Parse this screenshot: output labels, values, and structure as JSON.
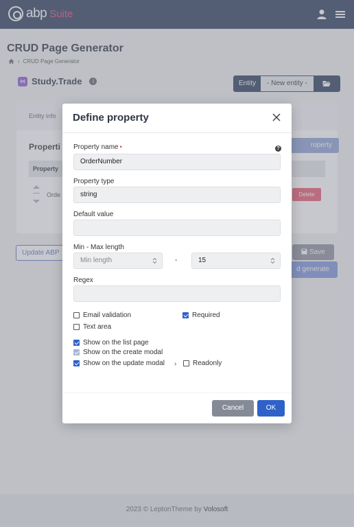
{
  "topbar": {
    "logo_text": "abp",
    "logo_suite": "Suite",
    "user_icon": "user-icon",
    "menu_icon": "hamburger-menu-icon"
  },
  "page": {
    "title": "CRUD Page Generator",
    "breadcrumb": "CRUD Page Generator"
  },
  "solution": {
    "name": "Study.Trade",
    "info_icon": "i"
  },
  "entity": {
    "label": "Entity",
    "selected": "- New entity -"
  },
  "card": {
    "tab_entity_info": "Entity info",
    "properties_title": "Properti",
    "add_property_label": "roperty",
    "column_property": "Property",
    "row_name": "Orde",
    "delete_label": "Delete"
  },
  "actions": {
    "update_label": "Update ABP",
    "save_label": "Save",
    "generate_label": "d generate"
  },
  "footer": {
    "text": "2023 © LeptonTheme by ",
    "brand": "Volosoft"
  },
  "modal": {
    "title": "Define property",
    "property_name_label": "Property name",
    "required_mark": "•",
    "property_name_value": "OrderNumber",
    "property_type_label": "Property type",
    "property_type_value": "string",
    "default_value_label": "Default value",
    "default_value_value": "",
    "minmax_label": "Min - Max length",
    "min_placeholder": "Min length",
    "dash": "-",
    "max_value": "15",
    "regex_label": "Regex",
    "regex_value": "",
    "checkboxes": {
      "email_validation": "Email validation",
      "required": "Required",
      "text_area": "Text area",
      "show_list": "Show on the list page",
      "show_create": "Show on the create modal",
      "show_update": "Show on the update modal",
      "readonly": "Readonly"
    },
    "cancel_label": "Cancel",
    "ok_label": "OK"
  },
  "colors": {
    "primary": "#2f62c8",
    "topbar": "#2c3e60",
    "danger": "#ea5a74",
    "brand_accent": "#e6457a"
  }
}
